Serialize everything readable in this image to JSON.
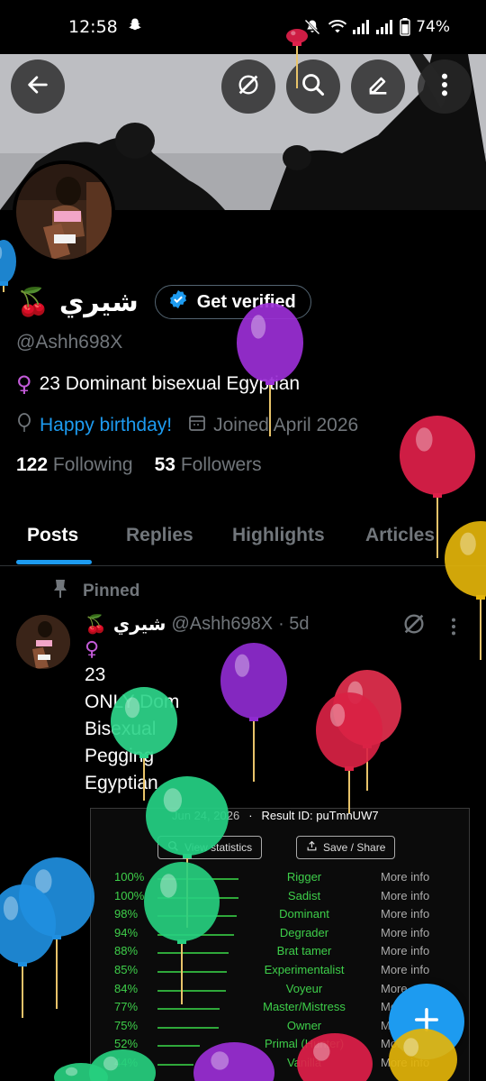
{
  "status_bar": {
    "time": "12:58",
    "battery": "74%",
    "icons": [
      "snapchat-icon",
      "mute-icon",
      "wifi-icon",
      "signal-icon",
      "signal-icon",
      "battery-icon"
    ]
  },
  "header": {
    "buttons": [
      "back-icon",
      "grok-icon",
      "search-icon",
      "edit-icon",
      "more-vertical-icon"
    ]
  },
  "profile": {
    "name": "شيري",
    "name_emoji": "🍒",
    "verify_label": "Get verified",
    "handle": "@Ashh698X",
    "bio_symbol": "♀",
    "bio": "23 Dominant bisexual Egyptian",
    "birthday": "Happy birthday!",
    "joined": "Joined April 2026",
    "following_count": "122",
    "following_label": "Following",
    "followers_count": "53",
    "followers_label": "Followers"
  },
  "tabs": [
    "Posts",
    "Replies",
    "Highlights",
    "Articles"
  ],
  "post": {
    "pinned_label": "Pinned",
    "author_emoji": "🍒",
    "author_name": "شيري",
    "author_handle": "@Ashh698X",
    "time": "· 5d",
    "lines": [
      "♀",
      "23",
      "ONLY Dom",
      "Bisexual",
      "Pegging",
      "Egyptian"
    ]
  },
  "embed": {
    "date": "Jun 24, 2026",
    "sep": "·",
    "result_id": "Result ID:  puTmnUW7",
    "view_stats": "View statistics",
    "save_share": "Save / Share",
    "results": [
      {
        "pct": "100%",
        "label": "Rigger",
        "more": "More info",
        "value": 1.0
      },
      {
        "pct": "100%",
        "label": "Sadist",
        "more": "More info",
        "value": 1.0
      },
      {
        "pct": "98%",
        "label": "Dominant",
        "more": "More info",
        "value": 0.98
      },
      {
        "pct": "94%",
        "label": "Degrader",
        "more": "More info",
        "value": 0.94
      },
      {
        "pct": "88%",
        "label": "Brat tamer",
        "more": "More info",
        "value": 0.88
      },
      {
        "pct": "85%",
        "label": "Experimentalist",
        "more": "More info",
        "value": 0.85
      },
      {
        "pct": "84%",
        "label": "Voyeur",
        "more": "More",
        "value": 0.84
      },
      {
        "pct": "77%",
        "label": "Master/Mistress",
        "more": "More info",
        "value": 0.77
      },
      {
        "pct": "75%",
        "label": "Owner",
        "more": "More info",
        "value": 0.75
      },
      {
        "pct": "52%",
        "label": "Primal (Hunter)",
        "more": "More",
        "value": 0.52
      },
      {
        "pct": "44%",
        "label": "Vanilla",
        "more": "More info",
        "value": 0.44
      }
    ]
  },
  "colors": {
    "accent": "#1d9bf0",
    "result_green": "#3ecf4a",
    "muted": "#71767b"
  }
}
